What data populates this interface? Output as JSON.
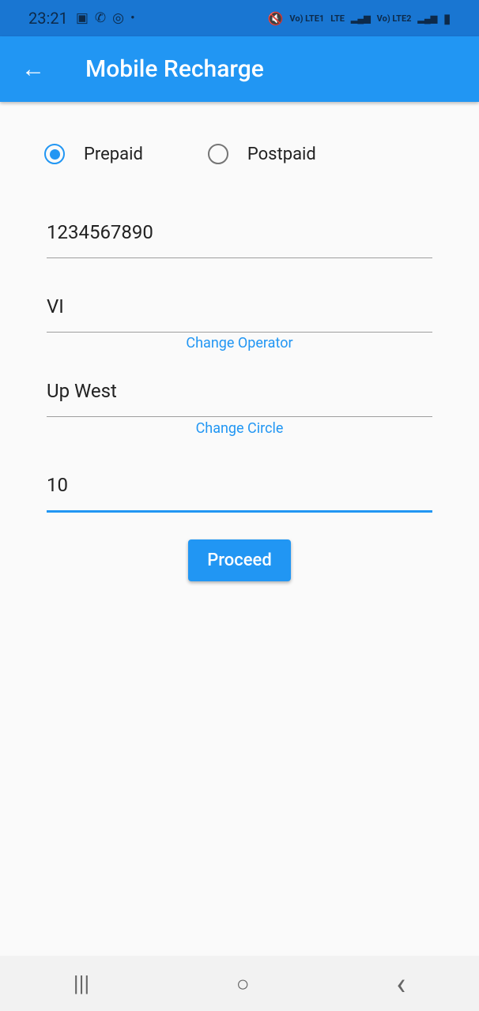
{
  "status_bar": {
    "time": "23:21",
    "notification_icons": [
      "gallery-icon",
      "whatsapp-icon",
      "sync-icon",
      "dot-icon"
    ],
    "right_labels": [
      "Vo) LTE1",
      "LTE",
      "Vo) LTE2"
    ]
  },
  "app_bar": {
    "title": "Mobile Recharge",
    "back_icon": "arrow-left-icon"
  },
  "plan_type": {
    "options": [
      "Prepaid",
      "Postpaid"
    ],
    "selected": "Prepaid"
  },
  "form": {
    "mobile_number": "1234567890",
    "operator": "VI",
    "change_operator": "Change Operator",
    "circle": "Up West",
    "change_circle": "Change Circle",
    "amount": "10"
  },
  "proceed_label": "Proceed",
  "nav_bar": {
    "recents": "|||",
    "home": "○",
    "back": "‹"
  },
  "colors": {
    "primary": "#2196f3",
    "status_bar": "#1976d2"
  }
}
